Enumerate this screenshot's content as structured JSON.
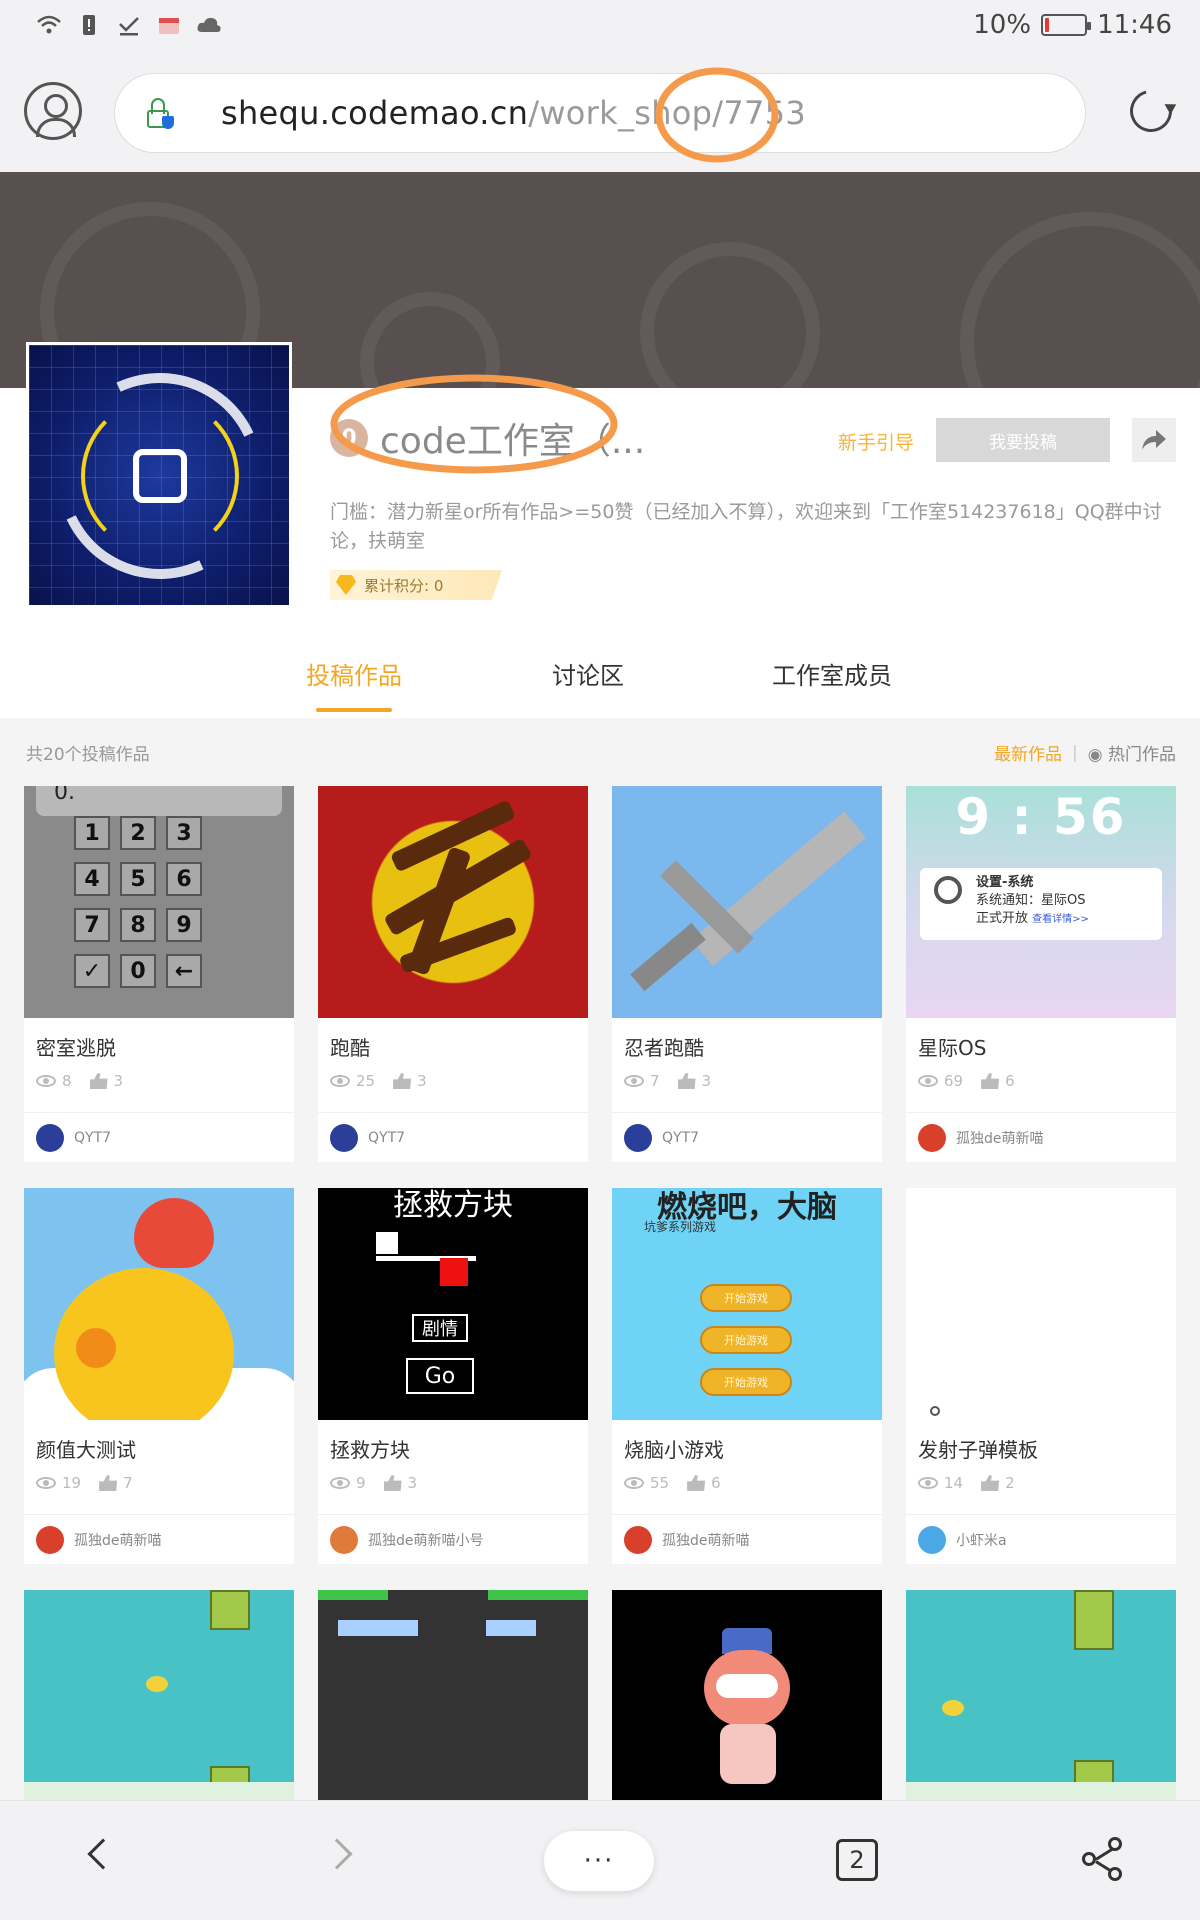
{
  "status_bar": {
    "battery": "10%",
    "battery_level": 0.1,
    "time": "11:46"
  },
  "browser": {
    "url_host": "shequ.codemao.cn",
    "url_path": "/work_shop/7753",
    "tab_count": "2",
    "menu_label": "···"
  },
  "studio": {
    "badge": "0",
    "title": "code工作室（...",
    "guide_link": "新手引导",
    "submit_button": "我要投稿",
    "description": "门槛：潜力新星or所有作品>=50赞（已经加入不算），欢迎来到「工作室514237618」QQ群中讨论，扶萌室",
    "points": "累计积分: 0"
  },
  "tabs": [
    {
      "label": "投稿作品",
      "active": true
    },
    {
      "label": "讨论区",
      "active": false
    },
    {
      "label": "工作室成员",
      "active": false
    }
  ],
  "list": {
    "count_text": "共20个投稿作品",
    "sort_latest": "最新作品",
    "sort_hot": "热门作品"
  },
  "works": [
    {
      "title": "密室逃脱",
      "views": "8",
      "likes": "3",
      "author": "QYT7",
      "avatar_color": "#2b3f9a"
    },
    {
      "title": "跑酷",
      "views": "25",
      "likes": "3",
      "author": "QYT7",
      "avatar_color": "#2b3f9a"
    },
    {
      "title": "忍者跑酷",
      "views": "7",
      "likes": "3",
      "author": "QYT7",
      "avatar_color": "#2b3f9a"
    },
    {
      "title": "星际OS",
      "views": "69",
      "likes": "6",
      "author": "孤独de萌新喵",
      "avatar_color": "#d8402c"
    },
    {
      "title": "颜值大测试",
      "views": "19",
      "likes": "7",
      "author": "孤独de萌新喵",
      "avatar_color": "#d8402c"
    },
    {
      "title": "拯救方块",
      "views": "9",
      "likes": "3",
      "author": "孤独de萌新喵小号",
      "avatar_color": "#e07a3a"
    },
    {
      "title": "烧脑小游戏",
      "views": "55",
      "likes": "6",
      "author": "孤独de萌新喵",
      "avatar_color": "#d8402c"
    },
    {
      "title": "发射子弹模板",
      "views": "14",
      "likes": "2",
      "author": "小虾米a",
      "avatar_color": "#4aa8e6"
    }
  ],
  "thumb_text": {
    "calc_keys": [
      "1",
      "2",
      "3",
      "4",
      "5",
      "6",
      "7",
      "8",
      "9",
      "✓",
      "0",
      "←"
    ],
    "calc_top": "0.",
    "os_clock": "9 : 56",
    "os_notif_title": "设置-系统",
    "os_notif_body": "系统通知：星际OS",
    "os_notif_body2": "正式开放",
    "os_notif_link": "查看详情>>",
    "save_title": "拯救方块",
    "save_btn1": "剧情",
    "save_btn2": "Go",
    "burn_title": "燃烧吧，大脑",
    "burn_sub": "坑爹系列游戏",
    "burn_btn": "开始游戏"
  }
}
